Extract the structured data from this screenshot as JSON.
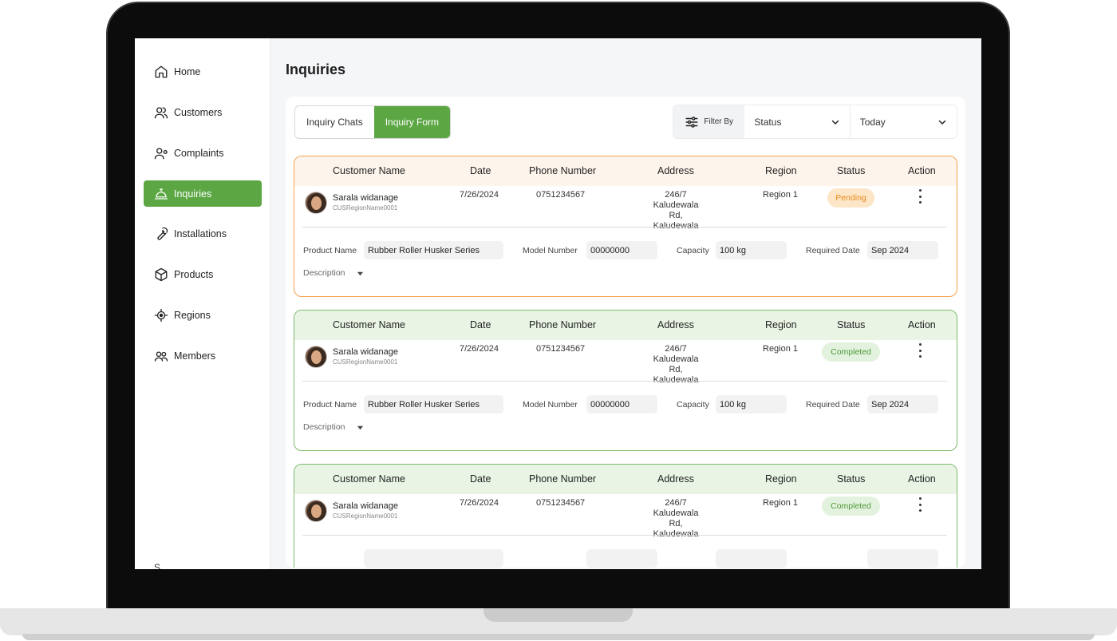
{
  "sidebar": {
    "items": [
      {
        "label": "Home",
        "icon": "home-icon"
      },
      {
        "label": "Customers",
        "icon": "users-icon"
      },
      {
        "label": "Complaints",
        "icon": "user-alert-icon"
      },
      {
        "label": "Inquiries",
        "icon": "service-bell-icon",
        "active": true
      },
      {
        "label": "Installations",
        "icon": "wrench-icon"
      },
      {
        "label": "Products",
        "icon": "box-icon"
      },
      {
        "label": "Regions",
        "icon": "location-target-icon"
      },
      {
        "label": "Members",
        "icon": "members-icon"
      }
    ],
    "footer_label": "S"
  },
  "page": {
    "title": "Inquiries"
  },
  "tabs": [
    {
      "label": "Inquiry Chats",
      "active": false
    },
    {
      "label": "Inquiry Form",
      "active": true
    }
  ],
  "filters": {
    "filter_by_label": "Filter By",
    "status_value": "Status",
    "date_value": "Today"
  },
  "columns": {
    "customer": "Customer Name",
    "date": "Date",
    "phone": "Phone Number",
    "address": "Address",
    "region": "Region",
    "status": "Status",
    "action": "Action"
  },
  "fields": {
    "product_name": "Product Name",
    "model_number": "Model Number",
    "capacity": "Capacity",
    "required_date": "Required Date",
    "description": "Description"
  },
  "inquiries": [
    {
      "name": "Sarala widanage",
      "id": "CUSRegionName0001",
      "date": "7/26/2024",
      "phone": "0751234567",
      "address_1": "246/7",
      "address_2": "Kaludewala Rd,",
      "address_3": "Kaludewala",
      "region": "Region 1",
      "status": "Pending",
      "product_name": "Rubber Roller Husker Series",
      "model_number": "00000000",
      "capacity": "100 kg",
      "required_date": "Sep 2024"
    },
    {
      "name": "Sarala widanage",
      "id": "CUSRegionName0001",
      "date": "7/26/2024",
      "phone": "0751234567",
      "address_1": "246/7",
      "address_2": "Kaludewala Rd,",
      "address_3": "Kaludewala",
      "region": "Region 1",
      "status": "Completed",
      "product_name": "Rubber Roller Husker Series",
      "model_number": "00000000",
      "capacity": "100 kg",
      "required_date": "Sep 2024"
    },
    {
      "name": "Sarala widanage",
      "id": "CUSRegionName0001",
      "date": "7/26/2024",
      "phone": "0751234567",
      "address_1": "246/7",
      "address_2": "Kaludewala Rd,",
      "address_3": "Kaludewala",
      "region": "Region 1",
      "status": "Completed"
    }
  ],
  "colors": {
    "accent": "#5ca744",
    "pending_border": "#f4a24a",
    "completed_border": "#7cbb6a",
    "pending_badge": "#e88a1f",
    "completed_badge": "#4c9a38"
  }
}
